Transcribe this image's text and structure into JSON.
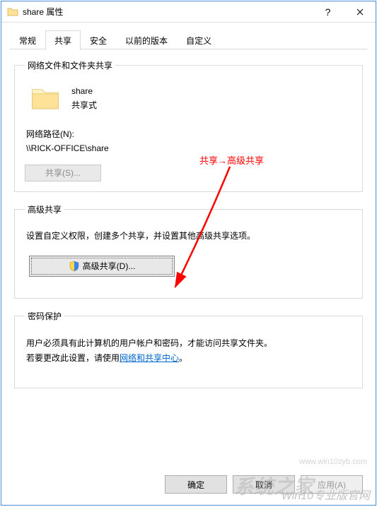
{
  "window": {
    "title": "share 属性"
  },
  "tabs": {
    "general": "常规",
    "share": "共享",
    "security": "安全",
    "previous": "以前的版本",
    "custom": "自定义",
    "active": "share"
  },
  "section1": {
    "legend": "网络文件和文件夹共享",
    "folder_name": "share",
    "folder_state": "共享式",
    "netpath_label": "网络路径(N):",
    "netpath_value": "\\\\RICK-OFFICE\\share",
    "share_button": "共享(S)..."
  },
  "section2": {
    "legend": "高级共享",
    "desc": "设置自定义权限，创建多个共享，并设置其他高级共享选项。",
    "button": "高级共享(D)..."
  },
  "section3": {
    "legend": "密码保护",
    "line1": "用户必须具有此计算机的用户帐户和密码，才能访问共享文件夹。",
    "line2_prefix": "若要更改此设置，请使用",
    "link": "网络和共享中心",
    "line2_suffix": "。"
  },
  "buttons": {
    "ok": "确定",
    "cancel": "取消",
    "apply": "应用(A)"
  },
  "annotation": {
    "text": "共享→高级共享"
  },
  "watermark": {
    "en": "Win10专业版官网",
    "url": "www.win10zyb.com",
    "cn": "系统之家"
  }
}
